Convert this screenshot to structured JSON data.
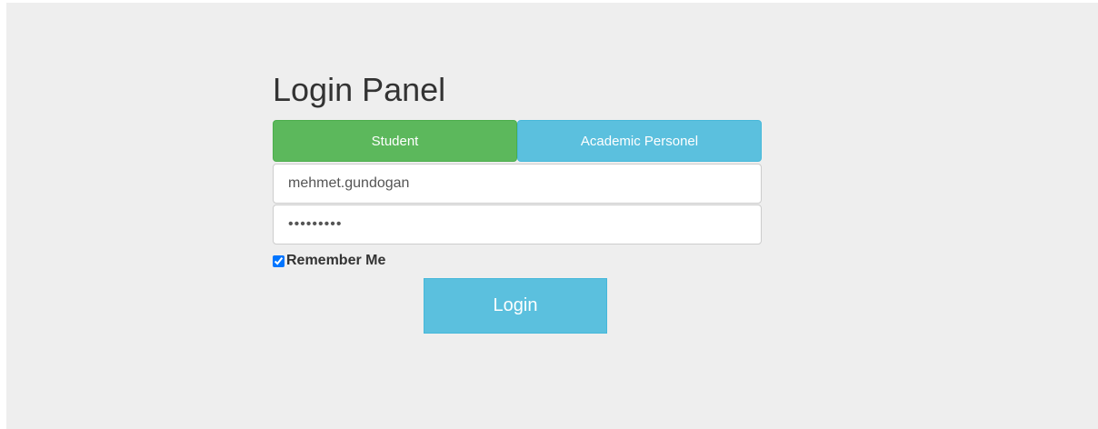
{
  "login": {
    "title": "Login Panel",
    "tabs": {
      "student": "Student",
      "academic": "Academic Personel"
    },
    "username": {
      "value": "mehmet.gundogan"
    },
    "password": {
      "value": "•••••••••"
    },
    "remember_me": {
      "label": "Remember Me",
      "checked": true
    },
    "submit_label": "Login"
  },
  "colors": {
    "background": "#eeeeee",
    "student_tab": "#5cb85c",
    "academic_tab": "#5bc0de",
    "login_button": "#5bc0de"
  }
}
